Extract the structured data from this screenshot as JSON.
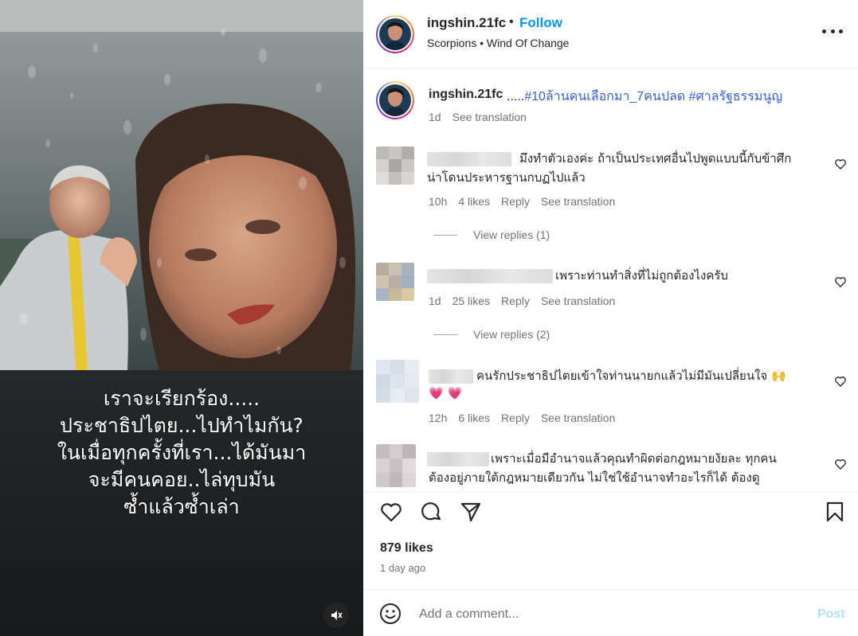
{
  "media": {
    "caption_lines": [
      "เราจะเรียกร้อง.....",
      "ประชาธิปไตย...ไปทำไมกัน?",
      "ในเมื่อทุกครั้งที่เรา...ได้มันมา",
      "จะมีคนคอย..ไล่ทุบมัน",
      "ซ้ำแล้วซ้ำเล่า"
    ],
    "mute_icon": "speaker-muted-icon"
  },
  "header": {
    "username": "ingshin.21fc",
    "separator": "•",
    "follow_label": "Follow",
    "audio": "Scorpions • Wind Of Change",
    "more_icon": "more-options-icon"
  },
  "caption": {
    "username": "ingshin.21fc",
    "prefix": ".....",
    "tags": [
      "#10ล้านคนเลือกมา_7คนปลด",
      "#ศาลรัฐธรรมนูญ"
    ],
    "time": "1d",
    "see_translation": "See translation"
  },
  "comments": [
    {
      "text_lines": [
        "มึงทำตัวเองค่ะ ถ้าเป็นประเทศอื่นไปพูดแบบนี้กับข้าศึก",
        "น่าโดนประหารฐานกบฏไปแล้ว"
      ],
      "time": "10h",
      "likes": "4 likes",
      "reply": "Reply",
      "see_translation": "See translation",
      "view_replies": "View replies (1)"
    },
    {
      "text_lines": [
        "เพราะท่านทำสิ่งที่ไม่ถูกต้องไงครับ"
      ],
      "time": "1d",
      "likes": "25 likes",
      "reply": "Reply",
      "see_translation": "See translation",
      "view_replies": "View replies (2)"
    },
    {
      "text_lines": [
        "คนรักประชาธิปไตยเข้าใจท่านนายกแล้วไม่มีมันเปลี่ยนใจ 🙌",
        "💗 💗"
      ],
      "time": "12h",
      "likes": "6 likes",
      "reply": "Reply",
      "see_translation": "See translation"
    },
    {
      "text_lines": [
        "เพราะเมื่อมีอำนาจแล้วคุณทำผิดต่อกฎหมายงัยละ ทุกคน",
        "ต้องอยู่ภายใต้กฎหมายเดียวกัน ไม่ใช่ใช้อำนาจทำอะไรก็ได้ ต้องดู"
      ]
    }
  ],
  "actions": {
    "like_icon": "heart-icon",
    "comment_icon": "comment-icon",
    "share_icon": "share-icon",
    "save_icon": "bookmark-icon"
  },
  "likes_count": "879 likes",
  "post_date": "1 day ago",
  "comment_box": {
    "placeholder": "Add a comment...",
    "post_label": "Post",
    "emoji_icon": "emoji-icon"
  },
  "colors": {
    "accent": "#0095f6",
    "hashtag": "#3a5fd8",
    "muted_text": "#737373",
    "post_disabled": "#b2dffc"
  }
}
